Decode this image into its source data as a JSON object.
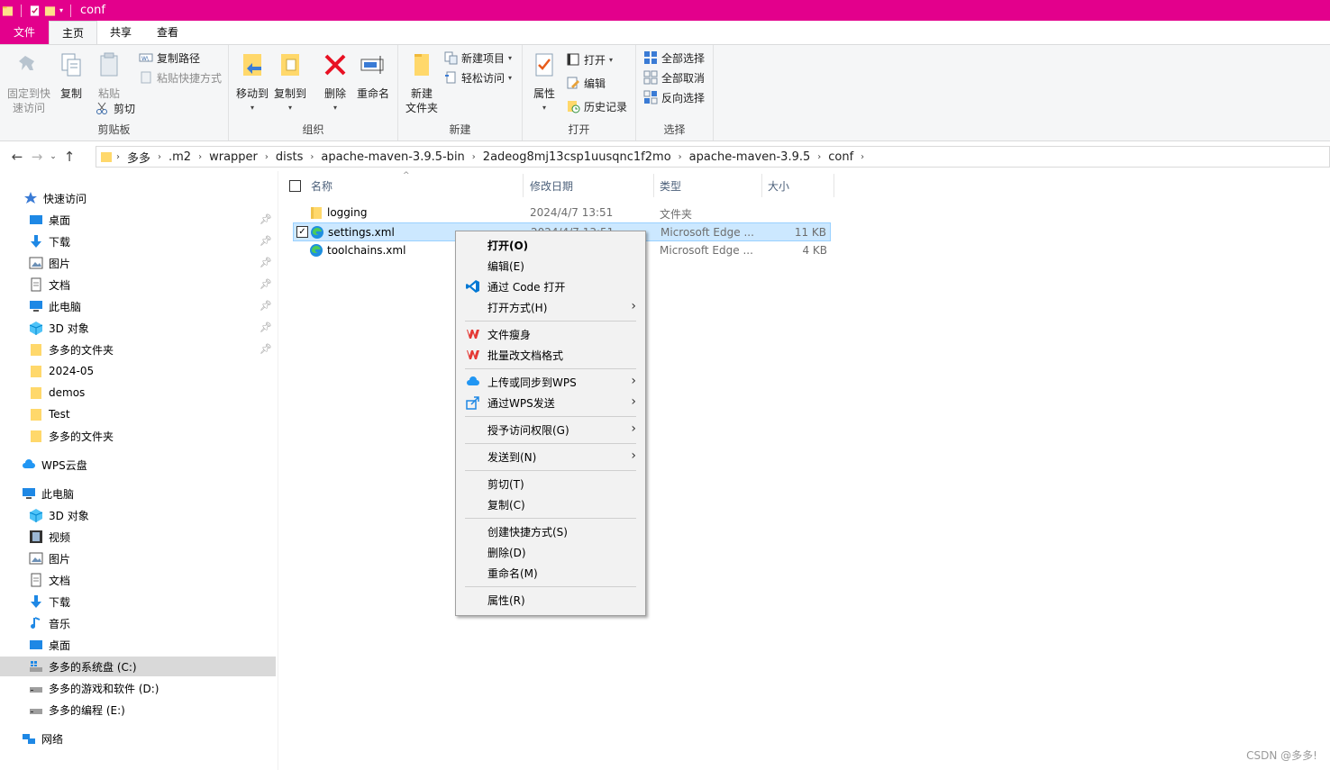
{
  "window": {
    "title": "conf"
  },
  "ribbon_tabs": [
    "文件",
    "主页",
    "共享",
    "查看"
  ],
  "ribbon": {
    "clipboard": {
      "label": "剪贴板",
      "pin_quick": "固定到快速访问",
      "pin_quick_line1": "固定到快",
      "pin_quick_line2": "速访问",
      "copy": "复制",
      "paste": "粘贴",
      "copy_path": "复制路径",
      "paste_shortcut": "粘贴快捷方式",
      "cut": "剪切"
    },
    "organize": {
      "label": "组织",
      "move_to": "移动到",
      "copy_to": "复制到",
      "delete": "删除",
      "rename": "重命名"
    },
    "new": {
      "label": "新建",
      "new_folder_line1": "新建",
      "new_folder_line2": "文件夹",
      "new_item": "新建项目",
      "easy_access": "轻松访问"
    },
    "open": {
      "label": "打开",
      "properties": "属性",
      "open": "打开",
      "edit": "编辑",
      "history": "历史记录"
    },
    "select": {
      "label": "选择",
      "select_all": "全部选择",
      "select_none": "全部取消",
      "invert": "反向选择"
    }
  },
  "breadcrumb": [
    "多多",
    ".m2",
    "wrapper",
    "dists",
    "apache-maven-3.9.5-bin",
    "2adeog8mj13csp1uusqnc1f2mo",
    "apache-maven-3.9.5",
    "conf"
  ],
  "sidebar": {
    "quick_access": "快速访问",
    "quick_items": [
      "桌面",
      "下载",
      "图片",
      "文档",
      "此电脑",
      "3D 对象",
      "多多的文件夹",
      "2024-05",
      "demos",
      "Test",
      "多多的文件夹"
    ],
    "wps_cloud": "WPS云盘",
    "this_pc": "此电脑",
    "pc_items": [
      "3D 对象",
      "视频",
      "图片",
      "文档",
      "下载",
      "音乐",
      "桌面",
      "多多的系统盘 (C:)",
      "多多的游戏和软件 (D:)",
      "多多的编程 (E:)"
    ],
    "network": "网络"
  },
  "columns": {
    "name": "名称",
    "date": "修改日期",
    "type": "类型",
    "size": "大小"
  },
  "files": [
    {
      "name": "logging",
      "date": "2024/4/7 13:51",
      "type": "文件夹",
      "size": ""
    },
    {
      "name": "settings.xml",
      "date": "2024/4/7 13:51",
      "type": "Microsoft Edge ...",
      "size": "11 KB"
    },
    {
      "name": "toolchains.xml",
      "date": "",
      "type": "Microsoft Edge ...",
      "size": "4 KB"
    }
  ],
  "context_menu": [
    {
      "label": "打开(O)"
    },
    {
      "label": "编辑(E)"
    },
    {
      "label": "通过 Code 打开"
    },
    {
      "label": "打开方式(H)"
    },
    {
      "label": "文件瘦身"
    },
    {
      "label": "批量改文档格式"
    },
    {
      "label": "上传或同步到WPS"
    },
    {
      "label": "通过WPS发送"
    },
    {
      "label": "授予访问权限(G)"
    },
    {
      "label": "发送到(N)"
    },
    {
      "label": "剪切(T)"
    },
    {
      "label": "复制(C)"
    },
    {
      "label": "创建快捷方式(S)"
    },
    {
      "label": "删除(D)"
    },
    {
      "label": "重命名(M)"
    },
    {
      "label": "属性(R)"
    }
  ],
  "watermark": "CSDN @多多!",
  "colors": {
    "accent": "#e3008c",
    "selection": "#cce8ff",
    "folder": "#ffd86b"
  }
}
